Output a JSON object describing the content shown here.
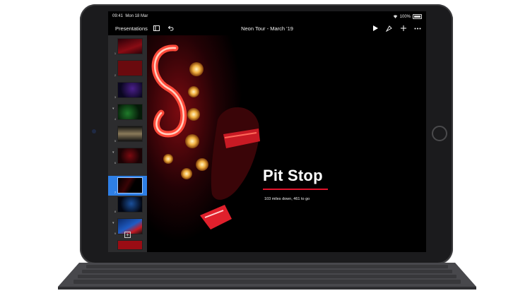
{
  "status_bar": {
    "time": "09:41",
    "date": "Mon 18 Mar",
    "battery": "100%"
  },
  "toolbar": {
    "back_label": "Presentations",
    "title": "Neon Tour - March '19",
    "icons": [
      "sidebar-icon",
      "undo-icon",
      "play-icon",
      "format-brush-icon",
      "add-icon",
      "more-icon"
    ]
  },
  "navigator": {
    "slides": [
      {
        "number": "1"
      },
      {
        "number": "2"
      },
      {
        "number": "3"
      },
      {
        "number": "4"
      },
      {
        "number": "5"
      },
      {
        "number": "6"
      },
      {
        "number": "7"
      },
      {
        "number": "8"
      },
      {
        "number": "9"
      },
      {
        "number": "10"
      }
    ],
    "selected_slide": "7"
  },
  "slide": {
    "title": "Pit Stop",
    "subtitle": "103 miles down, 461 to go",
    "accent": "#e3122b"
  }
}
